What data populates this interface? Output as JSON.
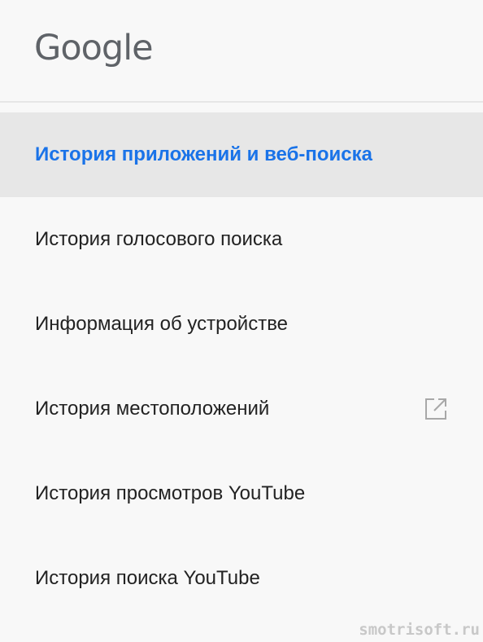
{
  "header": {
    "logo_text": "Google"
  },
  "nav": {
    "items": [
      {
        "label": "История приложений и веб-поиска",
        "active": true
      },
      {
        "label": "История голосового поиска",
        "active": false
      },
      {
        "label": "Информация об устройстве",
        "active": false
      },
      {
        "label": "История местоположений",
        "active": false,
        "icon": "open-in-new-icon"
      },
      {
        "label": "История просмотров YouTube",
        "active": false
      },
      {
        "label": "История поиска YouTube",
        "active": false
      }
    ]
  },
  "colors": {
    "active_text": "#1a73e8",
    "active_bg": "#e7e7e7",
    "text": "#222222",
    "logo": "#5f6368"
  },
  "watermark": "smotrisoft.ru"
}
